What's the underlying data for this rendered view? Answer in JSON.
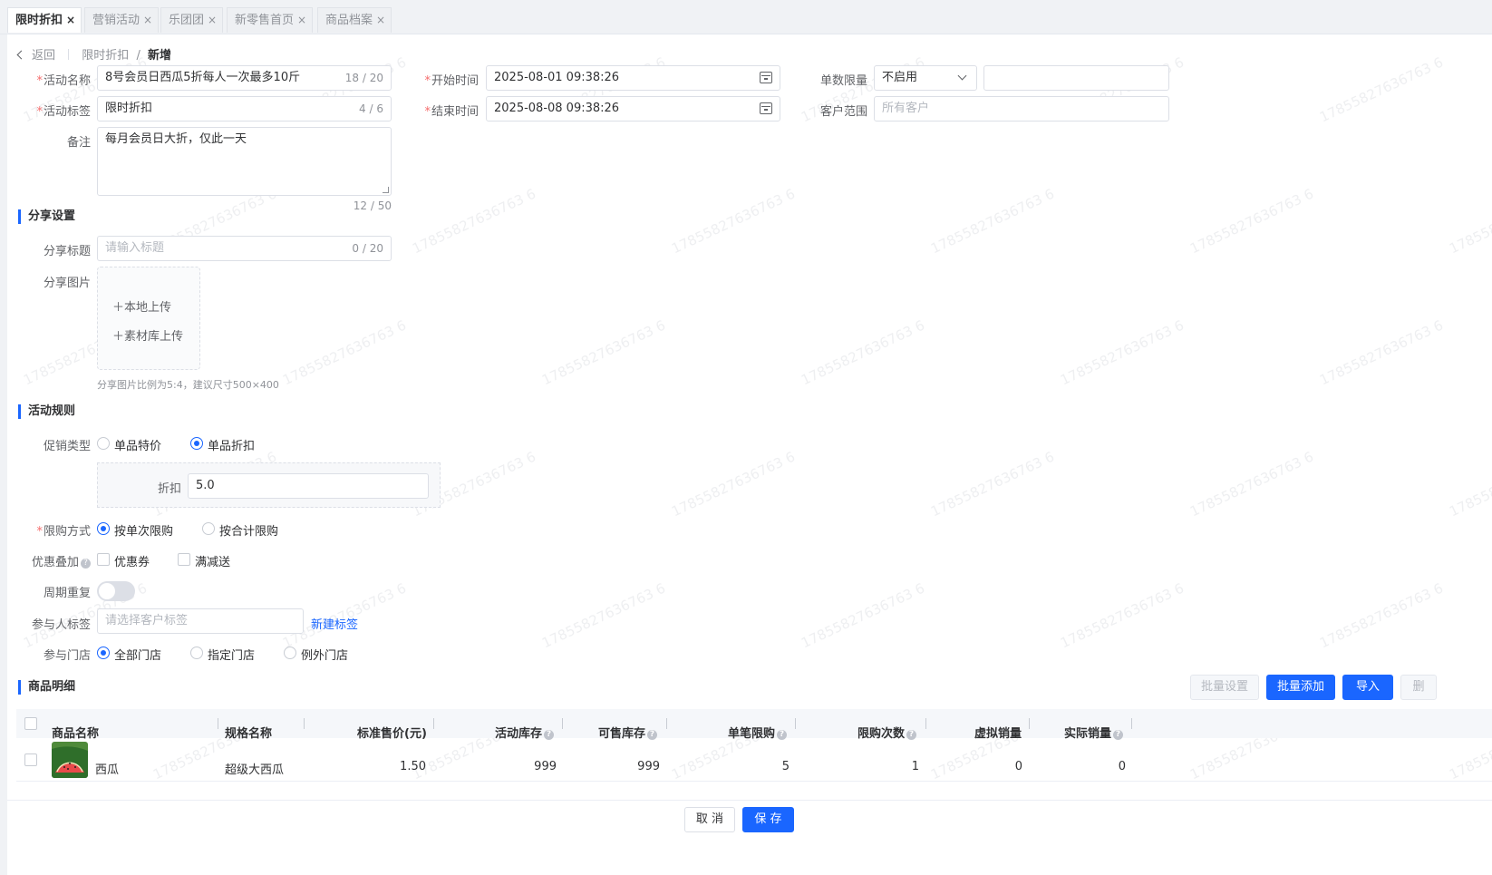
{
  "tabs": [
    {
      "label": "限时折扣",
      "active": true
    },
    {
      "label": "营销活动",
      "active": false
    },
    {
      "label": "乐团团",
      "active": false
    },
    {
      "label": "新零售首页",
      "active": false
    },
    {
      "label": "商品档案",
      "active": false
    }
  ],
  "tab_close": "×",
  "breadcrumb": {
    "back": "返回",
    "parent": "限时折扣",
    "sep": "/",
    "current": "新增"
  },
  "form": {
    "name_label": "活动名称",
    "name_value": "8号会员日西瓜5折每人一次最多10斤",
    "name_count": "18 / 20",
    "tag_label": "活动标签",
    "tag_value": "限时折扣",
    "tag_count": "4 / 6",
    "remark_label": "备注",
    "remark_value": "每月会员日大折，仅此一天",
    "remark_count": "12 / 50",
    "start_label": "开始时间",
    "start_value": "2025-08-01 09:38:26",
    "end_label": "结束时间",
    "end_value": "2025-08-08 09:38:26",
    "limit_label": "单数限量",
    "limit_value": "不启用",
    "limit_extra_value": "",
    "customer_label": "客户范围",
    "customer_placeholder": "所有客户"
  },
  "share": {
    "section_title": "分享设置",
    "title_label": "分享标题",
    "title_placeholder": "请输入标题",
    "title_count": "0 / 20",
    "image_label": "分享图片",
    "upload_local": "＋本地上传",
    "upload_library": "＋素材库上传",
    "image_hint": "分享图片比例为5:4，建议尺寸500×400"
  },
  "rules": {
    "section_title": "活动规则",
    "promo_label": "促销类型",
    "promo_options": [
      "单品特价",
      "单品折扣"
    ],
    "promo_selected": "单品折扣",
    "discount_label": "折扣",
    "discount_value": "5.0",
    "limit_mode_label": "限购方式",
    "limit_mode_options": [
      "按单次限购",
      "按合计限购"
    ],
    "limit_mode_selected": "按单次限购",
    "stack_label": "优惠叠加",
    "stack_options": [
      "优惠券",
      "满减送"
    ],
    "cycle_label": "周期重复",
    "cycle_on": false,
    "participant_label": "参与人标签",
    "participant_placeholder": "请选择客户标签",
    "new_tag_link": "新建标签",
    "store_label": "参与门店",
    "store_options": [
      "全部门店",
      "指定门店",
      "例外门店"
    ],
    "store_selected": "全部门店"
  },
  "products": {
    "section_title": "商品明细",
    "buttons": {
      "batch_set": "批量设置",
      "batch_add": "批量添加",
      "import": "导入",
      "delete": "删"
    },
    "columns": [
      "商品名称",
      "规格名称",
      "标准售价(元)",
      "活动库存",
      "可售库存",
      "单笔限购",
      "限购次数",
      "虚拟销量",
      "实际销量"
    ],
    "rows": [
      {
        "name": "西瓜",
        "spec": "超级大西瓜",
        "price": "1.50",
        "activity_stock": "999",
        "available_stock": "999",
        "per_order_limit": "5",
        "limit_times": "1",
        "virtual_sales": "0",
        "actual_sales": "0"
      }
    ]
  },
  "footer": {
    "cancel": "取 消",
    "save": "保 存"
  },
  "watermark": "17855827636763 6"
}
